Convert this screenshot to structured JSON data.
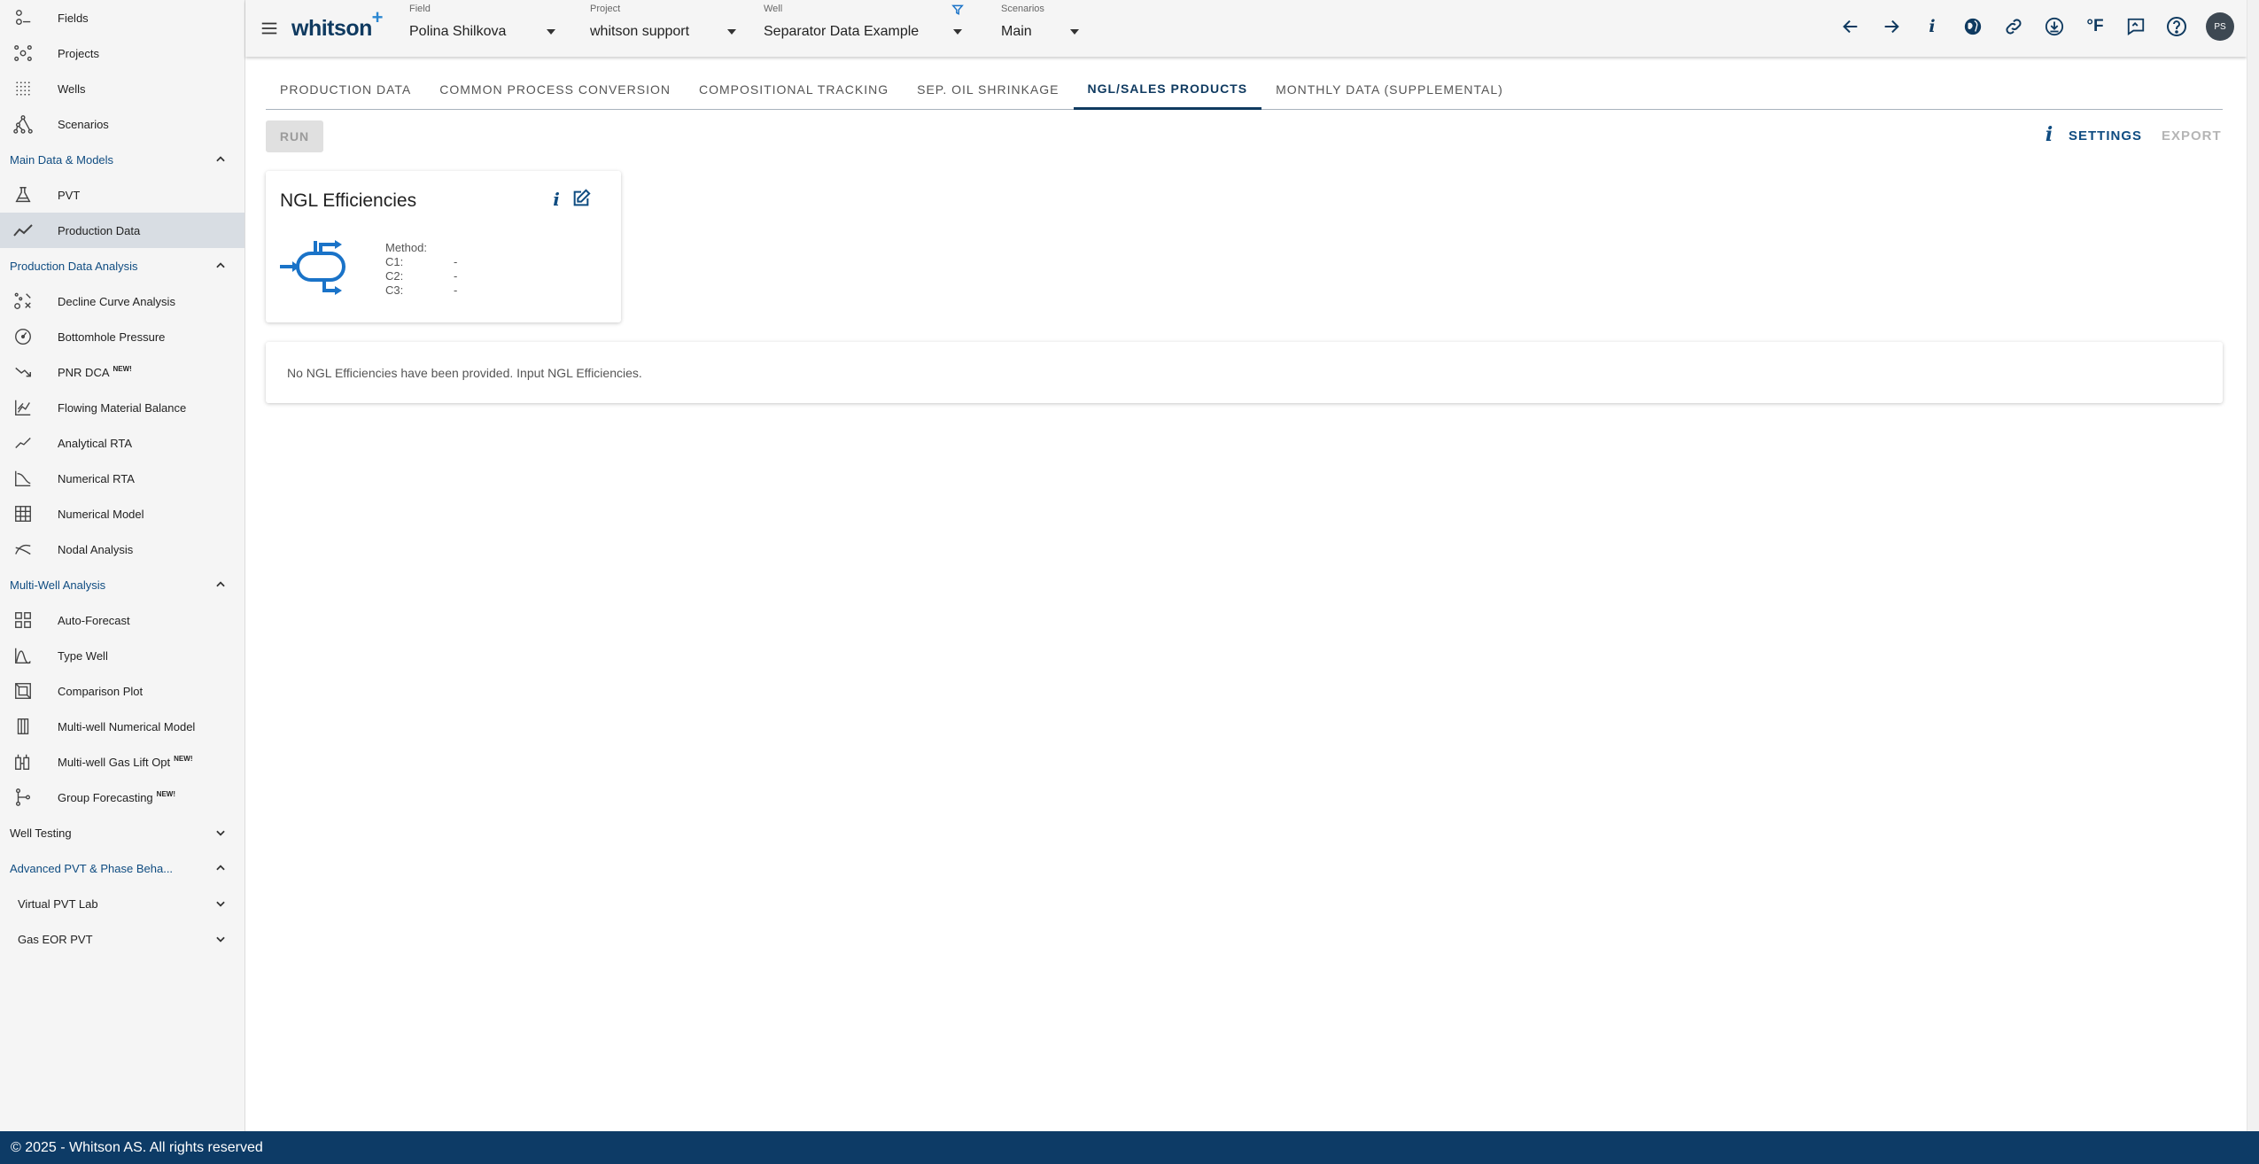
{
  "sidebar": {
    "top_items": [
      {
        "label": "Fields",
        "icon": "fields-icon"
      },
      {
        "label": "Projects",
        "icon": "projects-icon"
      },
      {
        "label": "Wells",
        "icon": "wells-icon"
      },
      {
        "label": "Scenarios",
        "icon": "scenarios-icon"
      }
    ],
    "sections": {
      "main_data": "Main Data & Models",
      "pda": "Production Data Analysis",
      "mwa": "Multi-Well Analysis",
      "well_testing": "Well Testing",
      "advanced_pvt": "Advanced PVT & Phase Beha...",
      "virtual_pvt_lab": "Virtual PVT Lab",
      "gas_eor_pvt": "Gas EOR PVT"
    },
    "main_items": [
      {
        "label": "PVT",
        "icon": "flask-icon"
      },
      {
        "label": "Production Data",
        "icon": "trend-line-icon"
      }
    ],
    "pda_items": [
      {
        "label": "Decline Curve Analysis",
        "icon": "decline-curve-icon"
      },
      {
        "label": "Bottomhole Pressure",
        "icon": "gauge-icon"
      },
      {
        "label": "PNR DCA",
        "icon": "trending-down-icon",
        "badge": "NEW!"
      },
      {
        "label": "Flowing Material Balance",
        "icon": "chart-axes-icon"
      },
      {
        "label": "Analytical RTA",
        "icon": "analytical-rta-icon"
      },
      {
        "label": "Numerical RTA",
        "icon": "numerical-rta-icon"
      },
      {
        "label": "Numerical Model",
        "icon": "grid-model-icon"
      },
      {
        "label": "Nodal Analysis",
        "icon": "nodal-icon"
      }
    ],
    "mwa_items": [
      {
        "label": "Auto-Forecast",
        "icon": "dashboard-grid-icon"
      },
      {
        "label": "Type Well",
        "icon": "bell-curve-icon"
      },
      {
        "label": "Comparison Plot",
        "icon": "comparison-icon"
      },
      {
        "label": "Multi-well Numerical Model",
        "icon": "columns-icon"
      },
      {
        "label": "Multi-well Gas Lift Opt",
        "icon": "gas-lift-icon",
        "badge": "NEW!"
      },
      {
        "label": "Group Forecasting",
        "icon": "group-forecast-icon",
        "badge": "NEW!"
      }
    ]
  },
  "topbar": {
    "logo": "whitson",
    "logo_plus": "+",
    "field": {
      "label": "Field",
      "value": "Polina Shilkova"
    },
    "project": {
      "label": "Project",
      "value": "whitson support"
    },
    "well": {
      "label": "Well",
      "value": "Separator Data Example"
    },
    "scenarios": {
      "label": "Scenarios",
      "value": "Main"
    },
    "info_glyph": "i",
    "unit_label": "°F",
    "avatar_initials": "PS"
  },
  "tabs": [
    {
      "label": "PRODUCTION DATA",
      "active": false
    },
    {
      "label": "COMMON PROCESS CONVERSION",
      "active": false
    },
    {
      "label": "COMPOSITIONAL TRACKING",
      "active": false
    },
    {
      "label": "SEP. OIL SHRINKAGE",
      "active": false
    },
    {
      "label": "NGL/SALES PRODUCTS",
      "active": true
    },
    {
      "label": "MONTHLY DATA (SUPPLEMENTAL)",
      "active": false
    }
  ],
  "actions": {
    "run_label": "RUN",
    "info_glyph": "i",
    "settings_label": "SETTINGS",
    "export_label": "EXPORT"
  },
  "card": {
    "title": "NGL Efficiencies",
    "info_glyph": "i",
    "method_label": "Method:",
    "method_value": "",
    "c1_label": "C1:",
    "c1_value": "-",
    "c2_label": "C2:",
    "c2_value": "-",
    "c3_label": "C3:",
    "c3_value": "-"
  },
  "message": "No NGL Efficiencies have been provided. Input NGL Efficiencies.",
  "footer": "© 2025 - Whitson AS. All rights reserved",
  "colors": {
    "brand_navy": "#0d3b66",
    "accent_blue": "#1a73c8",
    "active_nav_bg": "#d8dde3"
  }
}
